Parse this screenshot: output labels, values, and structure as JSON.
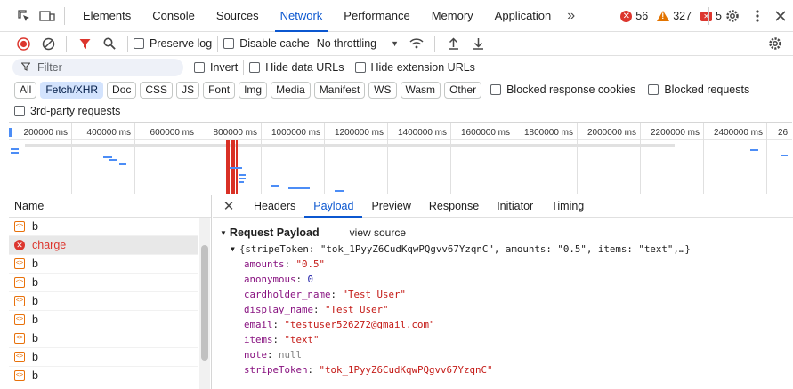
{
  "devtools": {
    "tabs": [
      "Elements",
      "Console",
      "Sources",
      "Network",
      "Performance",
      "Memory",
      "Application"
    ],
    "active_tab": "Network",
    "more_tabs_label": "»",
    "error_count": "56",
    "warning_count": "327",
    "issue_count": "5"
  },
  "network_toolbar": {
    "preserve_log": "Preserve log",
    "disable_cache": "Disable cache",
    "throttling": "No throttling"
  },
  "filter": {
    "placeholder": "Filter",
    "invert": "Invert",
    "hide_data_urls": "Hide data URLs",
    "hide_extension_urls": "Hide extension URLs"
  },
  "type_chips": [
    "All",
    "Fetch/XHR",
    "Doc",
    "CSS",
    "JS",
    "Font",
    "Img",
    "Media",
    "Manifest",
    "WS",
    "Wasm",
    "Other"
  ],
  "active_chip": "Fetch/XHR",
  "blocked_response_cookies": "Blocked response cookies",
  "blocked_requests": "Blocked requests",
  "third_party": "3rd-party requests",
  "overview": {
    "ticks": [
      "200000 ms",
      "400000 ms",
      "600000 ms",
      "800000 ms",
      "1000000 ms",
      "1200000 ms",
      "1400000 ms",
      "1600000 ms",
      "1800000 ms",
      "2000000 ms",
      "2200000 ms",
      "2400000 ms",
      "26"
    ]
  },
  "request_list": {
    "header": "Name",
    "items": [
      {
        "name": "b",
        "status": "ok"
      },
      {
        "name": "charge",
        "status": "error"
      },
      {
        "name": "b",
        "status": "ok"
      },
      {
        "name": "b",
        "status": "ok"
      },
      {
        "name": "b",
        "status": "ok"
      },
      {
        "name": "b",
        "status": "ok"
      },
      {
        "name": "b",
        "status": "ok"
      },
      {
        "name": "b",
        "status": "ok"
      },
      {
        "name": "b",
        "status": "ok"
      }
    ]
  },
  "detail": {
    "tabs": [
      "Headers",
      "Payload",
      "Preview",
      "Response",
      "Initiator",
      "Timing"
    ],
    "active_tab": "Payload",
    "section_title": "Request Payload",
    "view_source": "view source",
    "summary": "{stripeToken: \"tok_1PyyZ6CudKqwPQgvv67YzqnC\", amounts: \"0.5\", items: \"text\",…}",
    "fields": [
      {
        "key": "amounts",
        "value": "\"0.5\"",
        "kind": "string"
      },
      {
        "key": "anonymous",
        "value": "0",
        "kind": "number"
      },
      {
        "key": "cardholder_name",
        "value": "\"Test User\"",
        "kind": "string"
      },
      {
        "key": "display_name",
        "value": "\"Test User\"",
        "kind": "string"
      },
      {
        "key": "email",
        "value": "\"testuser526272@gmail.com\"",
        "kind": "string"
      },
      {
        "key": "items",
        "value": "\"text\"",
        "kind": "string"
      },
      {
        "key": "note",
        "value": "null",
        "kind": "null"
      },
      {
        "key": "stripeToken",
        "value": "\"tok_1PyyZ6CudKqwPQgvv67YzqnC\"",
        "kind": "string"
      }
    ]
  }
}
